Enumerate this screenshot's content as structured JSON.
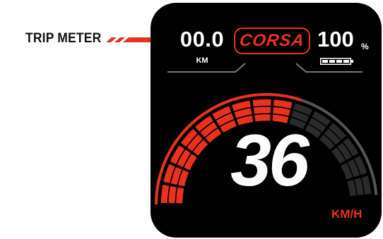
{
  "callout": {
    "label": "TRIP METER"
  },
  "display": {
    "trip": {
      "value": "00.0",
      "unit": "KM"
    },
    "mode": {
      "label": "CORSA"
    },
    "battery": {
      "value": "100",
      "unit": "%",
      "level_fraction": 1.0
    },
    "speed": {
      "value": "36",
      "unit": "KM/H",
      "gauge_fill_fraction": 0.62
    }
  },
  "colors": {
    "accent": "#e8321e",
    "screen_background": "#000000",
    "segment_off": "#2a2a2a",
    "text": "#ffffff"
  },
  "icons": [
    "battery-icon",
    "callout-stripe-icon"
  ]
}
